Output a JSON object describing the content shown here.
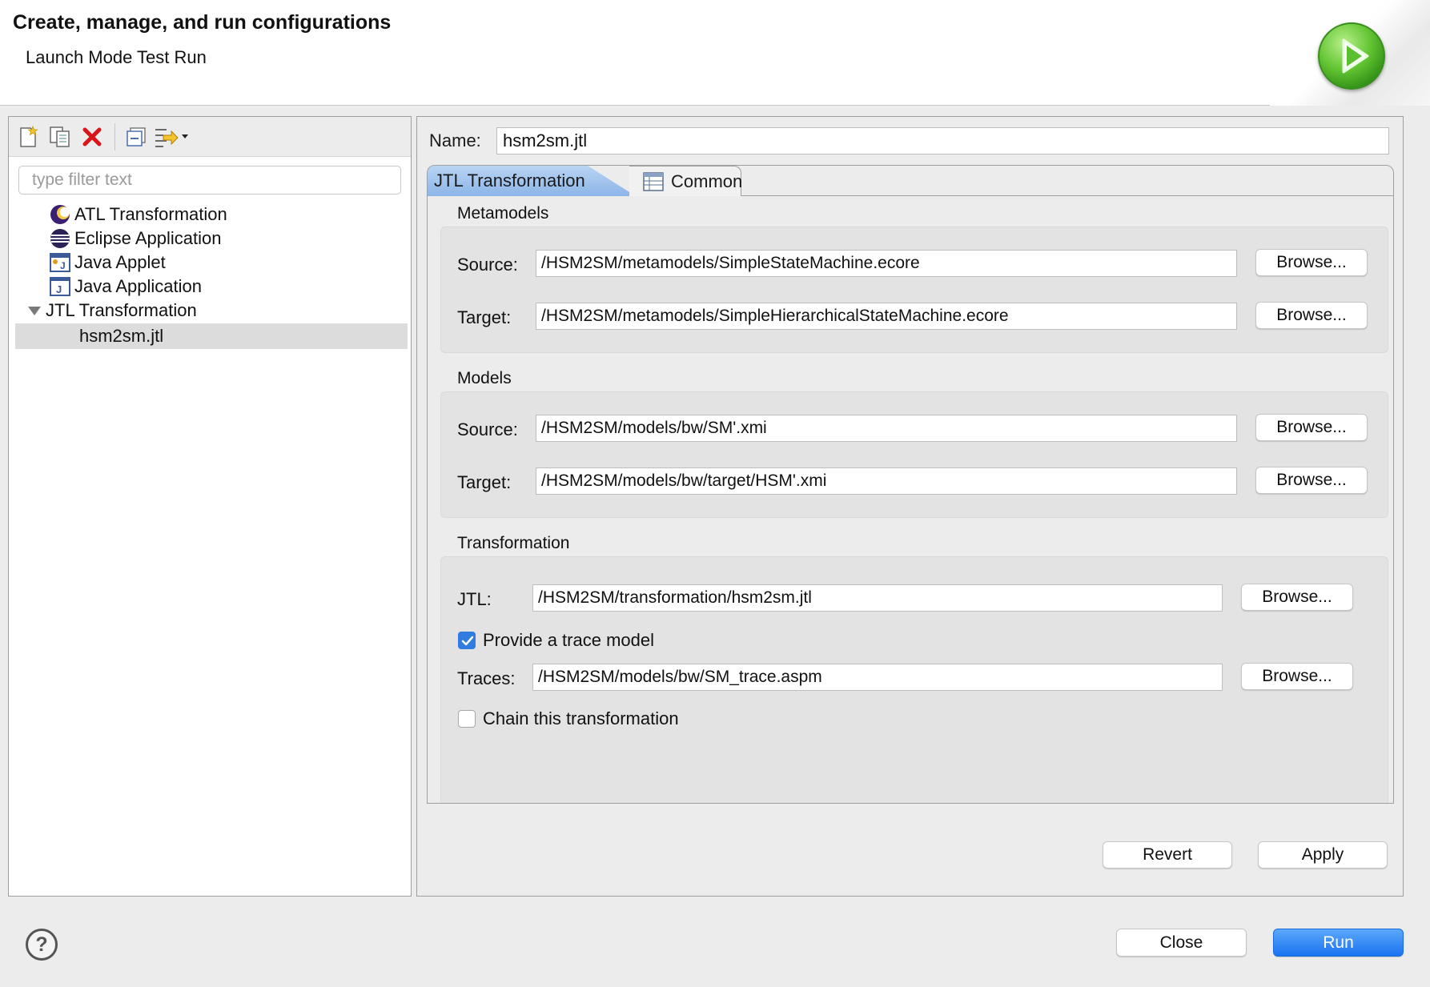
{
  "header": {
    "title": "Create, manage, and run configurations",
    "subtitle": "Launch Mode Test Run"
  },
  "left": {
    "filter_placeholder": "type filter text",
    "tree": [
      {
        "label": "ATL Transformation",
        "icon": "atl-icon"
      },
      {
        "label": "Eclipse Application",
        "icon": "eclipse-icon"
      },
      {
        "label": "Java Applet",
        "icon": "java-applet-icon"
      },
      {
        "label": "Java Application",
        "icon": "java-application-icon"
      },
      {
        "label": "JTL Transformation",
        "icon": "expand-triangle-icon",
        "expanded": true
      },
      {
        "label": "hsm2sm.jtl",
        "selected": true
      }
    ]
  },
  "right": {
    "name_label": "Name:",
    "name_value": "hsm2sm.jtl",
    "tabs": [
      {
        "label": "JTL Transformation",
        "active": true
      },
      {
        "label": "Common",
        "active": false
      }
    ],
    "metamodels": {
      "title": "Metamodels",
      "source_label": "Source:",
      "source_value": "/HSM2SM/metamodels/SimpleStateMachine.ecore",
      "target_label": "Target:",
      "target_value": "/HSM2SM/metamodels/SimpleHierarchicalStateMachine.ecore"
    },
    "models": {
      "title": "Models",
      "source_label": "Source:",
      "source_value": "/HSM2SM/models/bw/SM'.xmi",
      "target_label": "Target:",
      "target_value": "/HSM2SM/models/bw/target/HSM'.xmi"
    },
    "transformation": {
      "title": "Transformation",
      "jtl_label": "JTL:",
      "jtl_value": "/HSM2SM/transformation/hsm2sm.jtl",
      "trace_checkbox_label": "Provide a trace model",
      "trace_checked": true,
      "traces_label": "Traces:",
      "traces_value": "/HSM2SM/models/bw/SM_trace.aspm",
      "chain_checkbox_label": "Chain this transformation",
      "chain_checked": false
    },
    "browse_label": "Browse...",
    "revert_label": "Revert",
    "apply_label": "Apply"
  },
  "footer": {
    "close_label": "Close",
    "run_label": "Run"
  },
  "colors": {
    "run_button": "#1a73f0",
    "tab_active": "#8cb5e8",
    "checkbox_checked": "#2f7dde"
  }
}
